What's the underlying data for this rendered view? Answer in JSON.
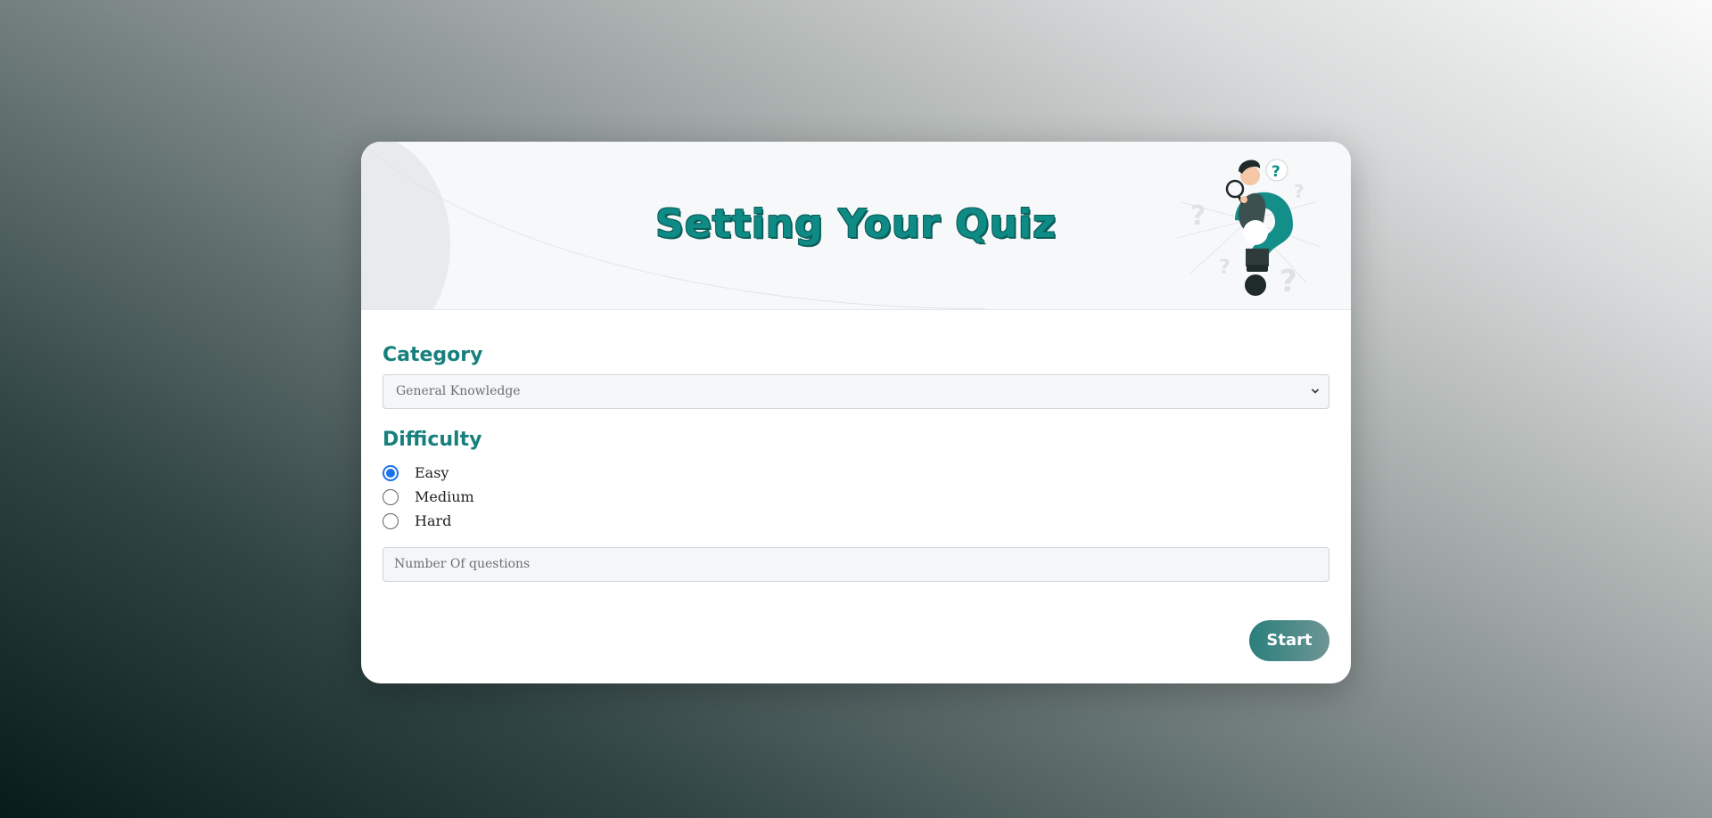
{
  "header": {
    "title": "Setting Your Quiz"
  },
  "category": {
    "label": "Category",
    "selected": "General Knowledge"
  },
  "difficulty": {
    "label": "Difficulty",
    "options": [
      {
        "label": "Easy",
        "checked": true
      },
      {
        "label": "Medium",
        "checked": false
      },
      {
        "label": "Hard",
        "checked": false
      }
    ]
  },
  "questions_input": {
    "placeholder": "Number Of questions"
  },
  "actions": {
    "start_label": "Start"
  },
  "icons": {
    "illustration": "question-mark-person-icon",
    "dropdown": "chevron-down-icon"
  },
  "colors": {
    "accent": "#17807d",
    "radio_checked": "#1a73e8",
    "button_start": "#2a7f7c"
  }
}
